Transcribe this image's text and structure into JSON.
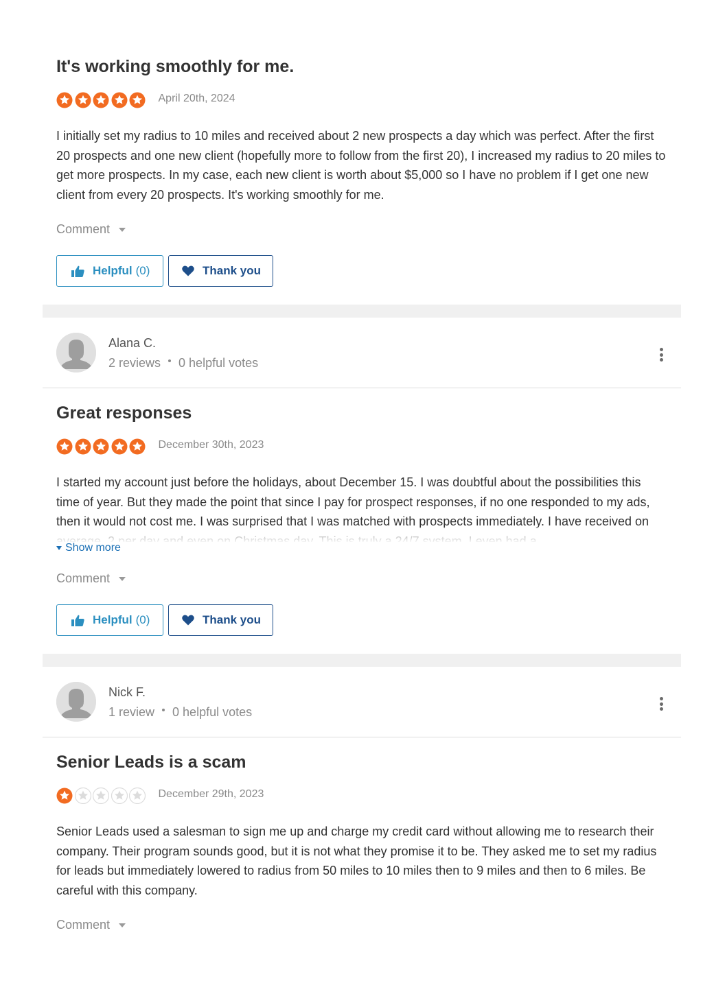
{
  "reviews": [
    {
      "title": "It's working smoothly for me.",
      "rating": 5,
      "date": "April 20th, 2024",
      "body": "I initially set my radius to 10 miles and received about 2 new prospects a day which was perfect. After the first 20 prospects and one new client (hopefully more to follow from the first 20), I increased my radius to 20 miles to get more prospects. In my case, each new client is worth about $5,000 so I have no problem if I get one new client from every 20 prospects. It's working smoothly for me.",
      "comment_label": "Comment",
      "helpful_label": "Helpful",
      "helpful_count": "(0)",
      "thank_label": "Thank you"
    },
    {
      "reviewer_name": "Alana C.",
      "reviewer_reviews": "2 reviews",
      "reviewer_votes": "0 helpful votes",
      "title": "Great responses",
      "rating": 5,
      "date": "December 30th, 2023",
      "body": "I started my account just before the holidays, about December 15. I was doubtful about the possibilities this time of year. But they made the point that since I pay for prospect responses, if no one responded to my ads, then it would not cost me. I was surprised that I was matched with prospects immediately. I have received on average, 2 per day and even on Christmas day. This is truly a 24/7 system. I even had a",
      "show_more_label": "Show more",
      "comment_label": "Comment",
      "helpful_label": "Helpful",
      "helpful_count": "(0)",
      "thank_label": "Thank you"
    },
    {
      "reviewer_name": "Nick F.",
      "reviewer_reviews": "1 review",
      "reviewer_votes": "0 helpful votes",
      "title": "Senior Leads is a scam",
      "rating": 1,
      "date": "December 29th, 2023",
      "body": "Senior Leads used a salesman to sign me up and charge my credit card without allowing me to research their company. Their program sounds good, but it is not what they promise it to be. They asked me to set my radius for leads but immediately lowered to radius from 50 miles to 10 miles then to 9 miles and then to 6 miles. Be careful with this company.",
      "comment_label": "Comment"
    }
  ],
  "colors": {
    "star_filled": "#f26b21",
    "star_empty": "#dcdcdc",
    "helpful": "#2b8fc0",
    "thank_you": "#1d4e8a",
    "link": "#1a6fb5"
  },
  "icons": [
    "star-icon",
    "thumbs-up-icon",
    "heart-icon",
    "more-vertical-icon",
    "avatar-placeholder-icon",
    "caret-down-icon"
  ]
}
